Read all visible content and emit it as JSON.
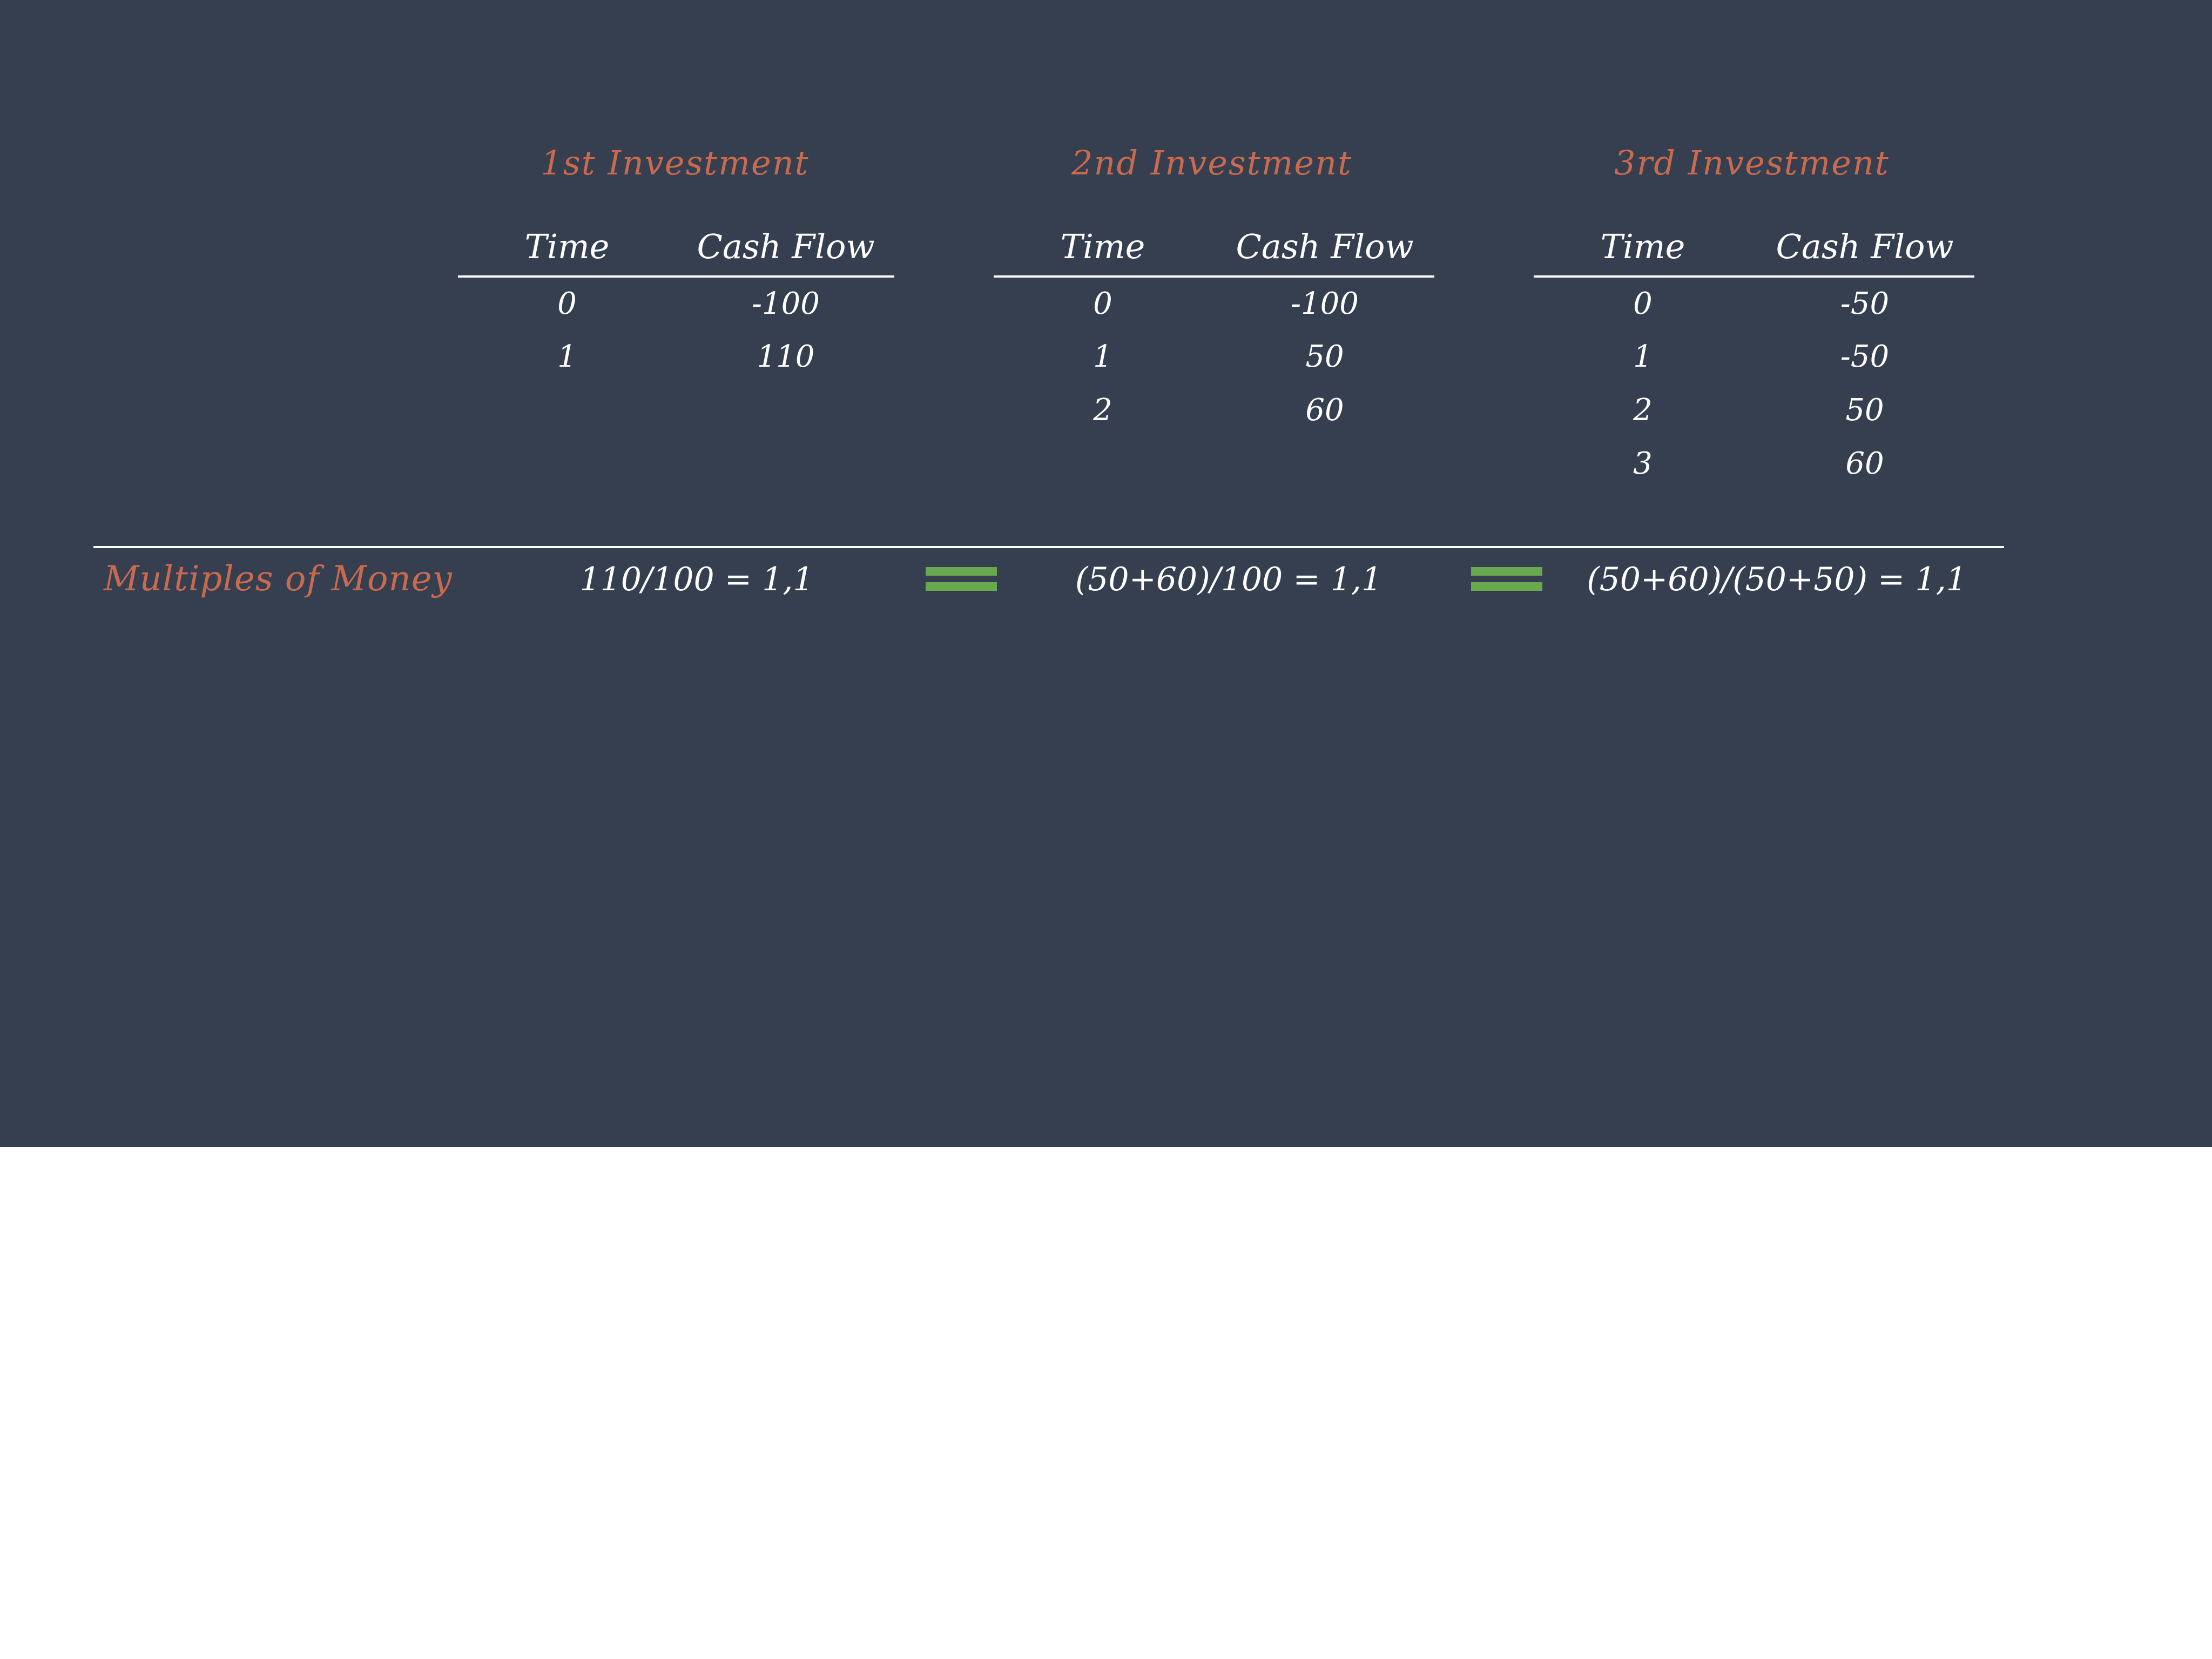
{
  "colors": {
    "background": "#353f4f",
    "accent": "#c96a4f",
    "text": "#ffffff",
    "equals": "#6aa84f"
  },
  "investments": [
    {
      "title": "1st Investment",
      "headers": [
        "Time",
        "Cash Flow"
      ],
      "rows": [
        [
          "0",
          "-100"
        ],
        [
          "1",
          "110"
        ]
      ]
    },
    {
      "title": "2nd Investment",
      "headers": [
        "Time",
        "Cash Flow"
      ],
      "rows": [
        [
          "0",
          "-100"
        ],
        [
          "1",
          "50"
        ],
        [
          "2",
          "60"
        ]
      ]
    },
    {
      "title": "3rd Investment",
      "headers": [
        "Time",
        "Cash Flow"
      ],
      "rows": [
        [
          "0",
          "-50"
        ],
        [
          "1",
          "-50"
        ],
        [
          "2",
          "50"
        ],
        [
          "3",
          "60"
        ]
      ]
    }
  ],
  "multiples": {
    "label": "Multiples of Money",
    "formulas": [
      "110/100 = 1,1",
      "(50+60)/100 = 1,1",
      "(50+60)/(50+50) = 1,1"
    ],
    "equals_icon": "double-bar-equals-icon"
  }
}
